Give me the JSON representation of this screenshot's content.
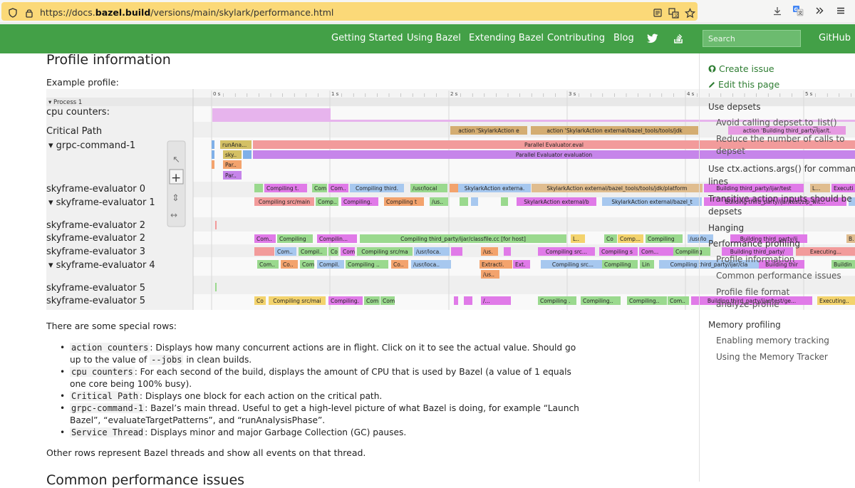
{
  "browser": {
    "url_prefix": "https://docs.",
    "url_domain": "bazel.build",
    "url_path": "/versions/main/skylark/performance.html",
    "icons": [
      "shield-icon",
      "lock-icon",
      "reader-icon",
      "translate-icon",
      "star-icon",
      "download-icon",
      "translate-ext-icon",
      "overflow-icon",
      "menu-icon"
    ]
  },
  "nav": {
    "links": [
      "Getting Started",
      "Using Bazel",
      "Extending Bazel",
      "Contributing",
      "Blog"
    ],
    "search_placeholder": "Search",
    "github": "GitHub",
    "colors": {
      "bar": "#43a047"
    }
  },
  "content": {
    "heading": "Profile information",
    "example_label": "Example profile:",
    "special_rows_intro": "There are some special rows:",
    "bullets": [
      {
        "code": "action counters",
        "text": ": Displays how many concurrent actions are in flight. Click on it to see the actual value. Should go up to the value of ",
        "code2": "--jobs",
        "text2": " in clean builds."
      },
      {
        "code": "cpu counters",
        "text": ": For each second of the build, displays the amount of CPU that is used by Bazel (a value of 1 equals one core being 100% busy)."
      },
      {
        "code": "Critical Path",
        "text": ": Displays one block for each action on the critical path."
      },
      {
        "code": "grpc-command-1",
        "text": ": Bazel’s main thread. Useful to get a high-level picture of what Bazel is doing, for example “Launch Bazel”, “evaluateTargetPatterns”, and “runAnalysisPhase”."
      },
      {
        "code": "Service Thread",
        "text": ": Displays minor and major Garbage Collection (GC) pauses."
      }
    ],
    "other_rows": "Other rows represent Bazel threads and show all events on that thread.",
    "next_heading_partial": "Common performance issues"
  },
  "profile_image": {
    "process_label": "Process 1",
    "time_ticks": [
      "0 s",
      "1 s",
      "2 s",
      "3 s",
      "4 s",
      "5 s"
    ],
    "rows": [
      "cpu counters:",
      "Critical Path",
      "grpc-command-1",
      "skyframe-evaluator 0",
      "skyframe-evaluator 1",
      "skyframe-evaluator 2",
      "skyframe-evaluator 2",
      "skyframe-evaluator 3",
      "skyframe-evaluator 4",
      "skyframe-evaluator 5",
      "skyframe-evaluator 5"
    ],
    "blocks": [
      "action 'SkylarkAction ex...",
      "action 'SkylarkAction external/bazel_tools/tools/jdk/platform...",
      "action 'Building third_party/ijar/t...",
      "runAna...",
      "sky...",
      "Par...",
      "Par...",
      "Parallel Evaluator.eval",
      "Parallel Evaluator evaluation",
      "Compiling t...",
      "Com",
      "Com...",
      "Compiling third...",
      "/usr/local/g...",
      "SkylarkAction externa...",
      "SkylarkAction external/bazel_tools/tools/jdk/platformc...",
      "Building third_party/ijar/test/GenKotli...",
      "L...",
      "Executin...",
      "Compiling src/main...",
      "Comp...",
      "Compiling...",
      "Compiling t...",
      "/us...",
      "SkylarkAction external/baze...",
      "SkylarkAction external/bazel_tools/tools/jdk/platformc...",
      "Building third_party/ijar/test/zip_wit...",
      "Com...",
      "Compiling ...",
      "Compilin...",
      "Compiling third_party/ijar/classfile.cc [for host]",
      "L...",
      "Co",
      "Comp...",
      "Compiling ...",
      "/usr/local/g...",
      "Building third_party/ijar/test...",
      "B...",
      "Com...",
      "Compil...",
      "Co",
      "Com",
      "Compiling src/mai...",
      "/usr/loca...",
      "/us...",
      "Compiling src...",
      "Compiling s...",
      "Com...",
      "Compiling ...",
      "Building third_party/ijar/te...",
      "Executing...",
      "Com...",
      "Co...",
      "Com",
      "Compil...",
      "Compiling ...",
      "Co...",
      "/usr/loca...",
      "Extracti...",
      "Ext...",
      "Compiling src...",
      "Compiling ...",
      "Lin",
      "Compiling third_party/ijar/classfile.cc",
      "Building third_par...",
      "Buildin",
      "/us...",
      "Co",
      "Compiling src/mai...",
      "Compiling...",
      "Com",
      "Com",
      "/...",
      "Compiling ...",
      "Compiling...",
      "Compiling...",
      "Com...",
      "Building third_party/ijar/test/ge...",
      "Executing..."
    ]
  },
  "sidebar": {
    "create_issue": "Create issue",
    "edit_page": "Edit this page",
    "items": [
      {
        "label": "Use depsets",
        "level": 1
      },
      {
        "label": "Avoid calling depset.to_list()",
        "level": 2
      },
      {
        "label": "Reduce the number of calls to",
        "level": 2
      },
      {
        "label": "depset",
        "level": 2
      },
      {
        "label": "Use ctx.actions.args() for command",
        "level": 1
      },
      {
        "label": "lines",
        "level": 1
      },
      {
        "label": "Transitive action inputs should be",
        "level": 1
      },
      {
        "label": "depsets",
        "level": 1
      },
      {
        "label": "Hanging",
        "level": 1
      },
      {
        "label": "Performance profiling",
        "level": 1
      },
      {
        "label": "Profile information",
        "level": 2
      },
      {
        "label": "Common performance issues",
        "level": 2
      },
      {
        "label": "Profile file format",
        "level": 2
      },
      {
        "label": "analyze-profile",
        "level": 2
      },
      {
        "label": "Memory profiling",
        "level": 1
      },
      {
        "label": "Enabling memory tracking",
        "level": 2
      },
      {
        "label": "Using the Memory Tracker",
        "level": 2
      }
    ]
  }
}
